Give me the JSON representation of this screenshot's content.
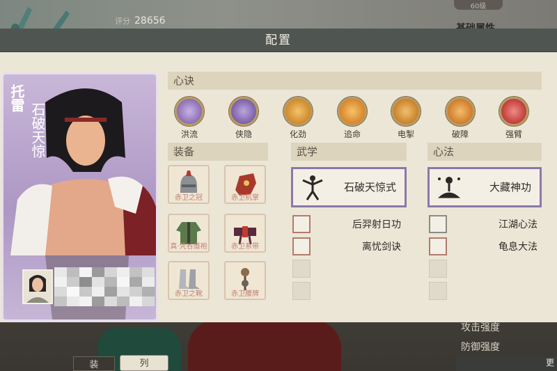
{
  "background": {
    "score_label": "评分",
    "score_value": "28656",
    "level_text": "60级",
    "base_attributes_label": "基础属性",
    "attack_label": "攻击强度",
    "defense_label": "防御强度",
    "bottom_tab_1": "装",
    "bottom_tab_2": "列",
    "bottom_right_text": "更"
  },
  "panel": {
    "title": "配置"
  },
  "character": {
    "title_tag": "托雷",
    "name": "石破天惊"
  },
  "sections": {
    "xinjue": "心诀",
    "zhuangbei": "装备",
    "wuxue": "武学",
    "xinfa": "心法"
  },
  "skills": [
    {
      "label": "洪流",
      "icon": "swirl-icon",
      "color": "#8a6fb5"
    },
    {
      "label": "侠隐",
      "icon": "cloud-icon",
      "color": "#7a5fa8"
    },
    {
      "label": "化劲",
      "icon": "palm-icon",
      "color": "#d08a2c"
    },
    {
      "label": "追命",
      "icon": "dash-icon",
      "color": "#d9852a"
    },
    {
      "label": "电掣",
      "icon": "lightning-icon",
      "color": "#c9812a"
    },
    {
      "label": "破障",
      "icon": "fist-icon",
      "color": "#d07b2c"
    },
    {
      "label": "强臂",
      "icon": "arm-icon",
      "color": "#c23b3b"
    }
  ],
  "equipment": [
    {
      "label": "赤卫之冠",
      "icon": "helmet-icon"
    },
    {
      "label": "赤卫机掌",
      "icon": "gauntlet-icon"
    },
    {
      "label": "真·凭谷道袍",
      "icon": "robe-icon"
    },
    {
      "label": "赤卫系带",
      "icon": "belt-icon"
    },
    {
      "label": "赤卫之靴",
      "icon": "boots-icon"
    },
    {
      "label": "赤卫腰牌",
      "icon": "pendant-icon"
    }
  ],
  "wuxue": {
    "main": "石破天惊式",
    "subs": [
      "后羿射日功",
      "离忧剑诀"
    ]
  },
  "xinfa": {
    "main": "大藏神功",
    "subs": [
      "江湖心法",
      "龟息大法"
    ]
  },
  "colors": {
    "header": "#4f5651",
    "panel_bg": "#ece6d7",
    "section_bar": "#ddd4bd",
    "card_purple": "#ad97c4",
    "main_skill_border": "#8b78a8"
  }
}
